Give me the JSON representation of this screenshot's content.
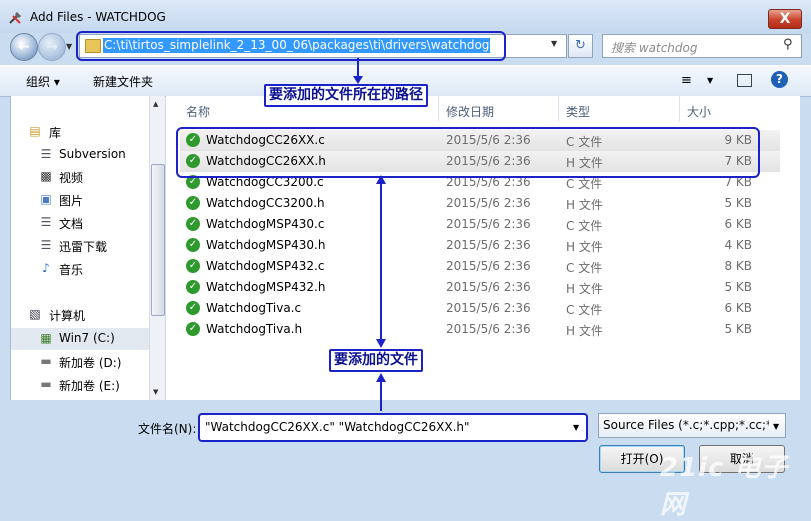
{
  "window": {
    "title": "Add Files - WATCHDOG",
    "close_label": "X"
  },
  "nav": {
    "address": "C:\\ti\\tirtos_simplelink_2_13_00_06\\packages\\ti\\drivers\\watchdog",
    "search_placeholder": "搜索 watchdog"
  },
  "toolbar": {
    "organize_label": "组织 ▾",
    "new_folder_label": "新建文件夹",
    "help_label": "?"
  },
  "sidebar": {
    "items": [
      {
        "label": "库",
        "icon": "library-icon"
      },
      {
        "label": "Subversion",
        "icon": "document-icon"
      },
      {
        "label": "视频",
        "icon": "video-icon"
      },
      {
        "label": "图片",
        "icon": "picture-icon"
      },
      {
        "label": "文档",
        "icon": "document-icon"
      },
      {
        "label": "迅雷下载",
        "icon": "download-icon"
      },
      {
        "label": "音乐",
        "icon": "music-icon"
      },
      {
        "label": "计算机",
        "icon": "computer-icon"
      },
      {
        "label": "Win7 (C:)",
        "icon": "drive-icon"
      },
      {
        "label": "新加卷 (D:)",
        "icon": "drive-icon"
      },
      {
        "label": "新加卷 (E:)",
        "icon": "drive-icon"
      }
    ]
  },
  "files": {
    "columns": {
      "name": "名称",
      "date": "修改日期",
      "type": "类型",
      "size": "大小"
    },
    "rows": [
      {
        "name": "WatchdogCC26XX.c",
        "date": "2015/5/6 2:36",
        "type": "C 文件",
        "size": "9 KB"
      },
      {
        "name": "WatchdogCC26XX.h",
        "date": "2015/5/6 2:36",
        "type": "H 文件",
        "size": "7 KB"
      },
      {
        "name": "WatchdogCC3200.c",
        "date": "2015/5/6 2:36",
        "type": "C 文件",
        "size": "7 KB"
      },
      {
        "name": "WatchdogCC3200.h",
        "date": "2015/5/6 2:36",
        "type": "H 文件",
        "size": "5 KB"
      },
      {
        "name": "WatchdogMSP430.c",
        "date": "2015/5/6 2:36",
        "type": "C 文件",
        "size": "6 KB"
      },
      {
        "name": "WatchdogMSP430.h",
        "date": "2015/5/6 2:36",
        "type": "H 文件",
        "size": "4 KB"
      },
      {
        "name": "WatchdogMSP432.c",
        "date": "2015/5/6 2:36",
        "type": "C 文件",
        "size": "8 KB"
      },
      {
        "name": "WatchdogMSP432.h",
        "date": "2015/5/6 2:36",
        "type": "H 文件",
        "size": "5 KB"
      },
      {
        "name": "WatchdogTiva.c",
        "date": "2015/5/6 2:36",
        "type": "C 文件",
        "size": "6 KB"
      },
      {
        "name": "WatchdogTiva.h",
        "date": "2015/5/6 2:36",
        "type": "H 文件",
        "size": "5 KB"
      }
    ]
  },
  "annotations": {
    "path_label": "要添加的文件所在的路径",
    "files_label": "要添加的文件",
    "color": "#1a22c8"
  },
  "bottom": {
    "filename_label": "文件名(N):",
    "filename_value": "\"WatchdogCC26XX.c\" \"WatchdogCC26XX.h\"",
    "filetype_value": "Source Files (*.c;*.cpp;*.cc;*.h",
    "open_label": "打开(O)",
    "cancel_label": "取消"
  },
  "watermark": "21ic 电子网"
}
